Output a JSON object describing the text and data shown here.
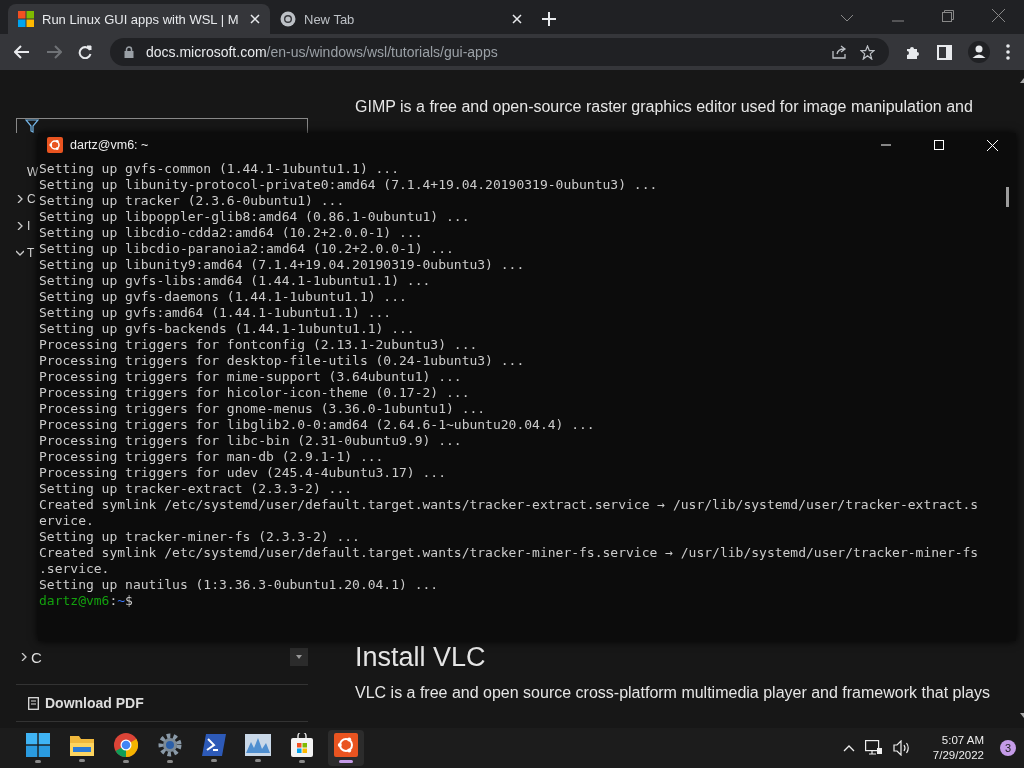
{
  "browser": {
    "tabs": [
      {
        "title": "Run Linux GUI apps with WSL | M",
        "kind": "ms",
        "selected": true
      },
      {
        "title": "New Tab",
        "kind": "chrome",
        "selected": false
      }
    ],
    "address": {
      "host": "docs.microsoft.com",
      "path": "/en-us/windows/wsl/tutorials/gui-apps"
    }
  },
  "sidebar": {
    "items": [
      {
        "label": "W",
        "kind": "heading"
      },
      {
        "label": "C",
        "kind": "node",
        "expanded": false
      },
      {
        "label": "I",
        "kind": "node",
        "expanded": false
      },
      {
        "label": "T",
        "kind": "node",
        "expanded": true
      }
    ],
    "bottom_item": {
      "label": "C",
      "expanded": false
    },
    "download": "Download PDF"
  },
  "article": {
    "intro": "GIMP is a free and open-source raster graphics editor used for image manipulation and",
    "heading": "Install VLC",
    "body": "VLC is a free and open source cross-platform multimedia player and framework that plays"
  },
  "terminal": {
    "title": "dartz@vm6: ~",
    "lines": [
      "Setting up gvfs-common (1.44.1-1ubuntu1.1) ...",
      "Setting up libunity-protocol-private0:amd64 (7.1.4+19.04.20190319-0ubuntu3) ...",
      "Setting up tracker (2.3.6-0ubuntu1) ...",
      "Setting up libpoppler-glib8:amd64 (0.86.1-0ubuntu1) ...",
      "Setting up libcdio-cdda2:amd64 (10.2+2.0.0-1) ...",
      "Setting up libcdio-paranoia2:amd64 (10.2+2.0.0-1) ...",
      "Setting up libunity9:amd64 (7.1.4+19.04.20190319-0ubuntu3) ...",
      "Setting up gvfs-libs:amd64 (1.44.1-1ubuntu1.1) ...",
      "Setting up gvfs-daemons (1.44.1-1ubuntu1.1) ...",
      "Setting up gvfs:amd64 (1.44.1-1ubuntu1.1) ...",
      "Setting up gvfs-backends (1.44.1-1ubuntu1.1) ...",
      "Processing triggers for fontconfig (2.13.1-2ubuntu3) ...",
      "Processing triggers for desktop-file-utils (0.24-1ubuntu3) ...",
      "Processing triggers for mime-support (3.64ubuntu1) ...",
      "Processing triggers for hicolor-icon-theme (0.17-2) ...",
      "Processing triggers for gnome-menus (3.36.0-1ubuntu1) ...",
      "Processing triggers for libglib2.0-0:amd64 (2.64.6-1~ubuntu20.04.4) ...",
      "Processing triggers for libc-bin (2.31-0ubuntu9.9) ...",
      "Processing triggers for man-db (2.9.1-1) ...",
      "Processing triggers for udev (245.4-4ubuntu3.17) ...",
      "Setting up tracker-extract (2.3.3-2) ...",
      "Created symlink /etc/systemd/user/default.target.wants/tracker-extract.service → /usr/lib/systemd/user/tracker-extract.s",
      "ervice.",
      "Setting up tracker-miner-fs (2.3.3-2) ...",
      "Created symlink /etc/systemd/user/default.target.wants/tracker-miner-fs.service → /usr/lib/systemd/user/tracker-miner-fs",
      ".service.",
      "Setting up nautilus (1:3.36.3-0ubuntu1.20.04.1) ..."
    ],
    "prompt": {
      "user": "dartz@vm6",
      "separator": ":",
      "path": "~",
      "symbol": "$"
    }
  },
  "taskbar": {
    "apps": [
      {
        "kind": "start",
        "selected": false
      },
      {
        "kind": "folder",
        "selected": false
      },
      {
        "kind": "chrome",
        "selected": false
      },
      {
        "kind": "gear",
        "selected": false
      },
      {
        "kind": "shell",
        "selected": false
      },
      {
        "kind": "monitor",
        "selected": false
      },
      {
        "kind": "store",
        "selected": false
      },
      {
        "kind": "ubuntu",
        "selected": true
      }
    ],
    "time": "5:07 AM",
    "date": "7/29/2022",
    "notifications": "3"
  }
}
